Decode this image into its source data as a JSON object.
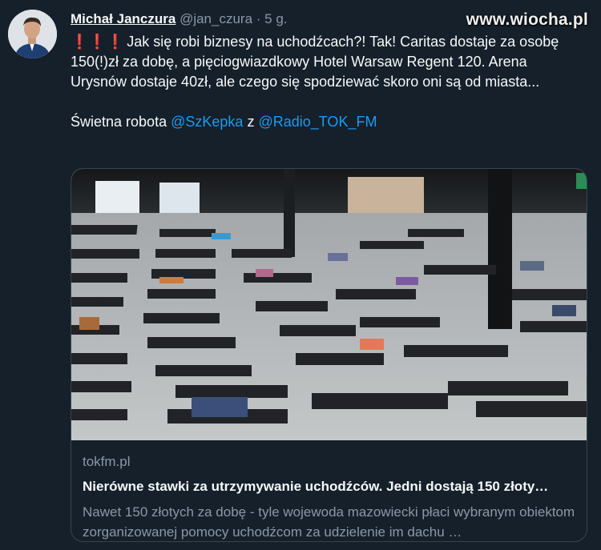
{
  "tweet": {
    "author_name": "Michał Janczura",
    "handle": "@jan_czura",
    "separator": "·",
    "time": "5 g.",
    "alert_icons": "❗❗❗",
    "text_line1": "Jak się robi biznesy na uchodźcach?! Tak! Caritas dostaje za osobę 150(!)zł za dobę, a pięciogwiazdkowy Hotel Warsaw Regent 120. Arena Urysnów dostaje 40zł, ale czego się spodziewać skoro oni są od miasta...",
    "text_line2_prefix": "Świetna robota",
    "mention1": "@SzKepka",
    "connector": "z",
    "mention2": "@Radio_TOK_FM"
  },
  "watermark": "www.wiocha.pl",
  "card": {
    "domain": "tokfm.pl",
    "title": "Nierówne stawki za utrzymywanie uchodźców. Jedni dostają 150 złoty…",
    "description": "Nawet 150 złotych za dobę - tyle wojewoda mazowiecki płaci wybranym obiektom zorganizowanej pomocy uchodźcom za udzielenie im dachu …"
  },
  "colors": {
    "background": "#15202b",
    "link": "#1d9bf0",
    "muted": "#8b98a5",
    "border": "#38444d"
  }
}
